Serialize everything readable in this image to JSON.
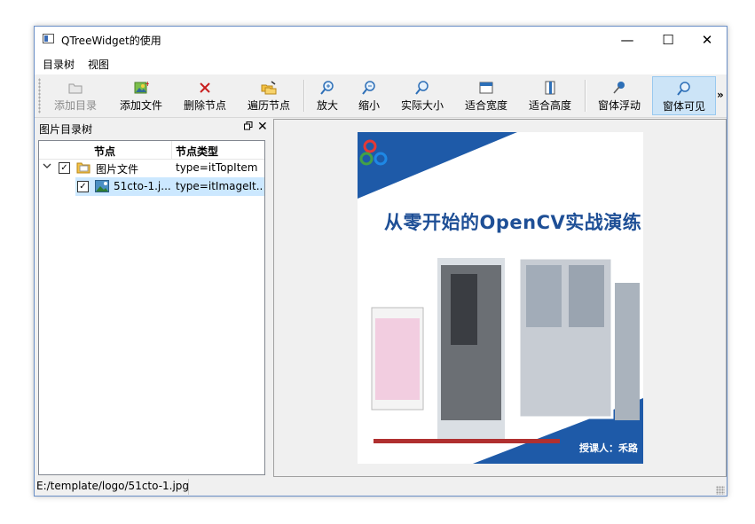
{
  "window": {
    "title": "QTreeWidget的使用",
    "minimize": "—",
    "maximize": "☐",
    "close": "✕"
  },
  "menu": [
    "目录树",
    "视图"
  ],
  "toolbar": {
    "add_dir": "添加目录",
    "add_file": "添加文件",
    "delete_node": "删除节点",
    "traverse": "遍历节点",
    "zoom_in": "放大",
    "zoom_out": "缩小",
    "actual_size": "实际大小",
    "fit_width": "适合宽度",
    "fit_height": "适合高度",
    "float_window": "窗体浮动",
    "window_visible": "窗体可见",
    "more": "»"
  },
  "dock": {
    "title": "图片目录树"
  },
  "tree": {
    "headers": [
      "节点",
      "节点类型"
    ],
    "rows": [
      {
        "label": "图片文件",
        "type": "type=itTopItem",
        "checked": true,
        "expanded": true
      },
      {
        "label": "51cto-1.j...",
        "type": "type=itImageIt...",
        "checked": true,
        "selected": true
      }
    ]
  },
  "image": {
    "logo": "CV",
    "headline": "从零开始的OpenCV实战演练",
    "footer": "授课人：禾路"
  },
  "status": {
    "path": "E:/template/logo/51cto-1.jpg"
  },
  "colors": {
    "accent": "#cce4f7",
    "selection": "#cce8ff",
    "banner_blue": "#1e5aa8",
    "window_border": "#6a8fc7"
  }
}
